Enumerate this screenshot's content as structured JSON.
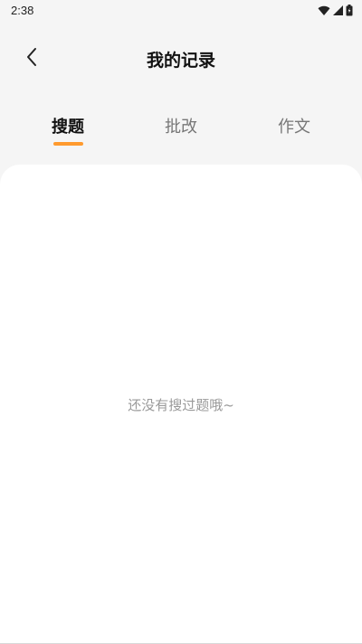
{
  "status_bar": {
    "time": "2:38",
    "icons": [
      "wifi-icon",
      "signal-icon",
      "battery-icon"
    ]
  },
  "header": {
    "title": "我的记录",
    "back_icon": "chevron-left-icon"
  },
  "tabs": [
    {
      "label": "搜题",
      "active": true
    },
    {
      "label": "批改",
      "active": false
    },
    {
      "label": "作文",
      "active": false
    }
  ],
  "content": {
    "empty_message": "还没有搜过题哦~"
  },
  "colors": {
    "accent": "#ff9a2e",
    "background": "#f5f5f5",
    "card": "#ffffff",
    "muted_text": "#999999"
  }
}
